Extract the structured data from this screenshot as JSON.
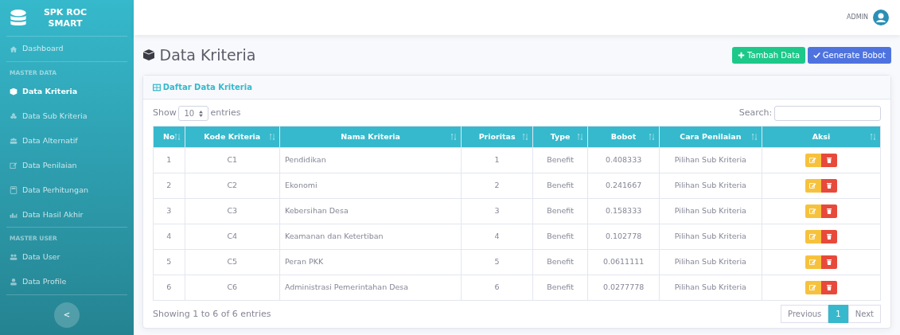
{
  "sidebar": {
    "brand": "SPK ROC SMART",
    "sections": [
      {
        "items": [
          {
            "label": "Dashboard",
            "selected": false
          }
        ]
      },
      {
        "heading": "MASTER DATA",
        "items": [
          {
            "label": "Data Kriteria",
            "selected": true
          },
          {
            "label": "Data Sub Kriteria",
            "selected": false
          },
          {
            "label": "Data Alternatif",
            "selected": false
          },
          {
            "label": "Data Penilaian",
            "selected": false
          },
          {
            "label": "Data Perhitungan",
            "selected": false
          },
          {
            "label": "Data Hasil Akhir",
            "selected": false
          }
        ]
      },
      {
        "heading": "MASTER USER",
        "items": [
          {
            "label": "Data User",
            "selected": false
          },
          {
            "label": "Data Profile",
            "selected": false
          }
        ]
      }
    ],
    "toggle": "<"
  },
  "topbar": {
    "user": "ADMIN"
  },
  "page": {
    "title": "Data Kriteria",
    "buttons": [
      {
        "label": "Tambah Data",
        "kind": "add"
      },
      {
        "label": "Generate Bobot",
        "kind": "generate"
      }
    ]
  },
  "card": {
    "title": "Daftar Data Kriteria",
    "show_label": "Show",
    "page_size": "10",
    "entries_label": "entries",
    "search_label": "Search:",
    "table": {
      "columns": [
        "No",
        "Kode Kriteria",
        "Nama Kriteria",
        "Prioritas",
        "Type",
        "Bobot",
        "Cara Penilaian",
        "Aksi"
      ],
      "rows": [
        [
          "1",
          "C1",
          "Pendidikan",
          "1",
          "Benefit",
          "0.408333",
          "Pilihan Sub Kriteria"
        ],
        [
          "2",
          "C2",
          "Ekonomi",
          "2",
          "Benefit",
          "0.241667",
          "Pilihan Sub Kriteria"
        ],
        [
          "3",
          "C3",
          "Kebersihan Desa",
          "3",
          "Benefit",
          "0.158333",
          "Pilihan Sub Kriteria"
        ],
        [
          "4",
          "C4",
          "Keamanan dan Ketertiban",
          "4",
          "Benefit",
          "0.102778",
          "Pilihan Sub Kriteria"
        ],
        [
          "5",
          "C5",
          "Peran PKK",
          "5",
          "Benefit",
          "0.0611111",
          "Pilihan Sub Kriteria"
        ],
        [
          "6",
          "C6",
          "Administrasi Pemerintahan Desa",
          "6",
          "Benefit",
          "0.0277778",
          "Pilihan Sub Kriteria"
        ]
      ]
    },
    "info": "Showing 1 to 6 of 6 entries",
    "pagination": [
      {
        "label": "Previous",
        "selected": false
      },
      {
        "label": "1",
        "selected": true
      },
      {
        "label": "Next",
        "selected": false
      }
    ]
  }
}
